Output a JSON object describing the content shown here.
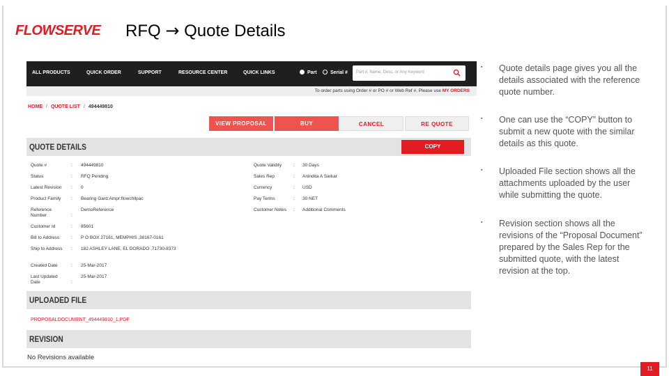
{
  "slide": {
    "logo": "FLOWSERVE",
    "title_left": "RFQ",
    "title_arrow": "→",
    "title_right": "Quote Details",
    "page_number": "11"
  },
  "nav": {
    "items": [
      "ALL PRODUCTS",
      "QUICK ORDER",
      "SUPPORT",
      "RESOURCE CENTER",
      "QUICK LINKS"
    ],
    "radio_part": "Part",
    "radio_serial": "Serial #",
    "search_placeholder": "Part #, Name, Desc. or Any Keyword",
    "subbar_text": "To order parts using Order # or PO # or Web Ref #, Please use",
    "subbar_link": "MY ORDERS"
  },
  "breadcrumb": {
    "home": "HOME",
    "list": "QUOTE LIST",
    "current": "494449810"
  },
  "buttons": {
    "view_proposal": "VIEW PROPOSAL",
    "buy": "BUY",
    "cancel": "CANCEL",
    "requote": "RE QUOTE",
    "copy": "COPY"
  },
  "sections": {
    "quote_details": "QUOTE DETAILS",
    "uploaded_file": "UPLOADED FILE",
    "revision": "REVISION"
  },
  "details_left": [
    {
      "label": "Quote #",
      "value": "494449810"
    },
    {
      "label": "Status",
      "value": "RFQ Pending"
    },
    {
      "label": "Latest Revision",
      "value": "0"
    },
    {
      "label": "Product Family",
      "value": "Bearing Gard:Ampr:flowchllpac"
    },
    {
      "label": "Reference Number",
      "value": "DemoReference"
    },
    {
      "label": "Customer Id",
      "value": "85601"
    },
    {
      "label": "Bill to Address",
      "value": "P O BOX 27161, MEMPHIS ,38167-0161"
    },
    {
      "label": "Ship to Address",
      "value": "182 ASHLEY LANE, EL DORADO ,71730-8373"
    },
    {
      "label": "Created Date",
      "value": "25-Mar-2017"
    },
    {
      "label": "Last Updated Date",
      "value": "25-Mar-2017"
    }
  ],
  "details_right": [
    {
      "label": "Quote Validity",
      "value": "30 Days"
    },
    {
      "label": "Sales Rep",
      "value": "Anindita A Sarkar"
    },
    {
      "label": "Currency",
      "value": "USD"
    },
    {
      "label": "Pay Terms",
      "value": "30 NET"
    },
    {
      "label": "Customer Notes",
      "value": "Additional Comments"
    }
  ],
  "uploaded_file": "PROPOSALDOCUMENT_494449810_1.PDF",
  "revision_text": "No Revisions available",
  "bullets": [
    "Quote details page gives you all the details associated with the reference quote number.",
    "One can use the “COPY” button to submit a new quote with the similar details as this quote.",
    "Uploaded File section shows all the attachments uploaded by the user while submitting the quote.",
    "Revision section shows all the revisions of the “Proposal Document” prepared by the Sales Rep for the submitted quote, with the latest revision at the top."
  ],
  "colors": {
    "brand_red": "#e31b23",
    "nav_bg": "#1f1f1f",
    "section_bg": "#e3e3e3"
  }
}
